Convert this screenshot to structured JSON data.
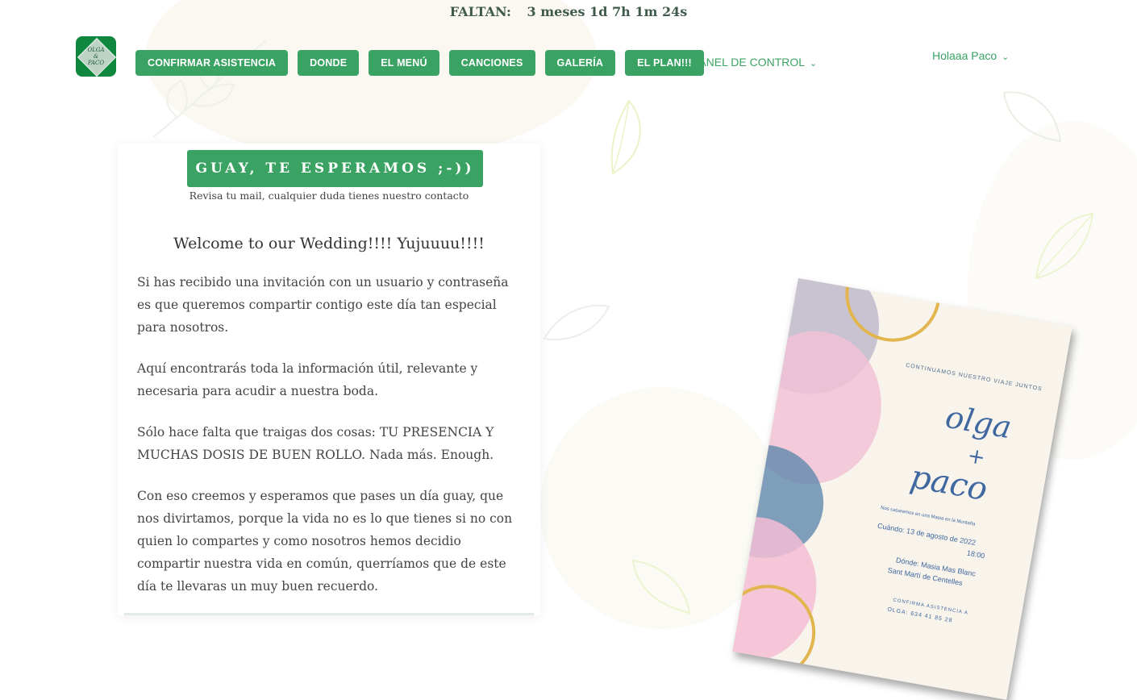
{
  "countdown": {
    "label": "FALTAN:",
    "value": "3 meses 1d 7h 1m 24s"
  },
  "logo": {
    "text_top": "OLGA",
    "text_mid": "&",
    "text_bottom": "PACO"
  },
  "nav": {
    "items": [
      "CONFIRMAR ASISTENCIA",
      "DONDE",
      "EL MENÚ",
      "CANCIONES",
      "GALERÍA",
      "EL PLAN!!!"
    ],
    "dropdown_label": "PANEL DE CONTROL"
  },
  "user": {
    "greeting": "Holaaa Paco"
  },
  "card": {
    "confirm_label": "GUAY, TE ESPERAMOS ;-))",
    "confirm_sub": "Revisa tu mail, cualquier duda tienes nuestro contacto",
    "welcome": "Welcome to our Wedding!!!! Yujuuuu!!!!",
    "paragraphs": [
      "Si has recibido una invitación con un usuario y contraseña es que queremos compartir contigo este día tan especial para nosotros.",
      "Aquí encontrarás toda la información útil, relevante y necesaria para acudir a nuestra boda.",
      "Sólo hace falta que traigas dos cosas: TU PRESENCIA Y MUCHAS DOSIS DE BUEN ROLLO. Nada más. Enough.",
      "Con eso creemos y esperamos que pases un día guay, que nos divirtamos, porque la vida no es lo que tienes si no con quien lo compartes y como nosotros hemos decidio compartir nuestra vida en común, querríamos que de este día te llevaras un muy buen recuerdo."
    ]
  },
  "invitation": {
    "heading": "CONTINUAMOS NUESTRO VIAJE JUNTOS",
    "name1": "olga",
    "plus": "+",
    "name2": "paco",
    "line1": "Nos casaremos en una Masia en la Montaña",
    "when": "Cuándo: 13 de agosto de 2022",
    "time": "18:00",
    "where1": "Dónde: Masia Mas Blanc",
    "where2": "Sant Martí de Centelles",
    "confirm1": "CONFIRMA ASISTENCIA A",
    "confirm2": "OLGA: 634 41 85 28"
  },
  "colors": {
    "accent": "#3aa363",
    "logo_bg": "#10873e",
    "text": "#444444"
  }
}
